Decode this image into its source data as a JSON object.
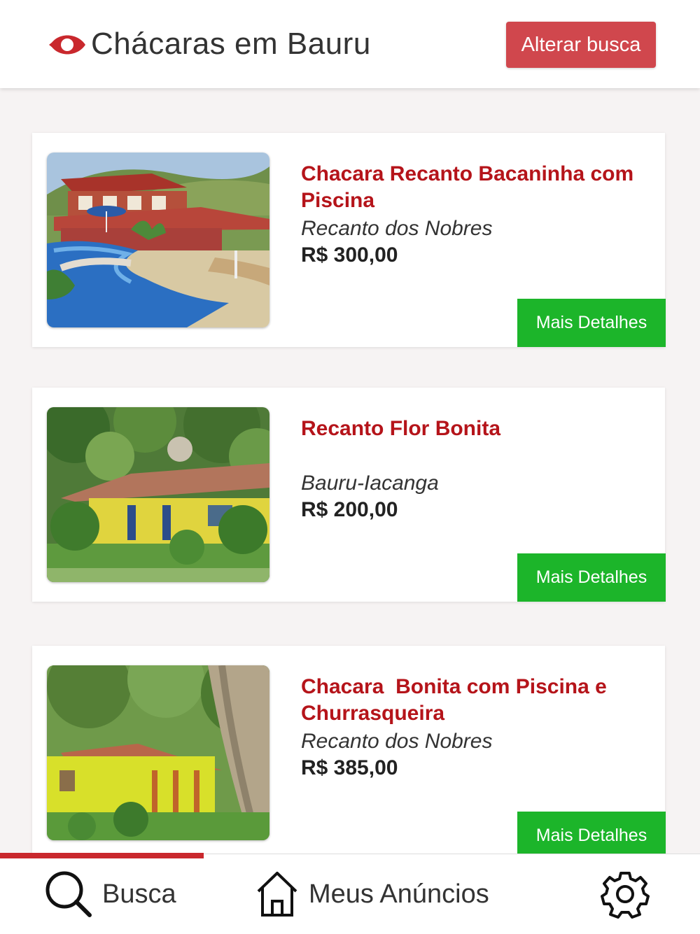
{
  "header": {
    "title": "Chácaras em Bauru",
    "alter_button": "Alterar busca",
    "brand_color": "#c9282d",
    "logo_icon": "eye-pin-logo-icon"
  },
  "listings": [
    {
      "title": "Chacara Recanto Bacaninha com Piscina",
      "location": "Recanto dos Nobres",
      "price": "R$ 300,00",
      "button": "Mais Detalhes",
      "image": "house-with-pool-photo"
    },
    {
      "title": "Recanto Flor Bonita",
      "location": "Bauru-Iacanga",
      "price": "R$ 200,00",
      "button": "Mais Detalhes",
      "image": "yellow-house-with-garden-photo"
    },
    {
      "title": "Chacara  Bonita com Piscina e Churrasqueira",
      "location": "Recanto dos Nobres",
      "price": "R$ 385,00",
      "button": "Mais Detalhes",
      "image": "yellow-house-under-tree-photo"
    }
  ],
  "tabs": [
    {
      "label": "Busca",
      "icon": "search-icon",
      "active": true
    },
    {
      "label": "Meus Anúncios",
      "icon": "home-icon",
      "active": false
    },
    {
      "label": "",
      "icon": "gear-icon",
      "active": false
    }
  ],
  "colors": {
    "title_red": "#b5141a",
    "button_green": "#1cb52a",
    "alter_button_red": "#d0474d"
  }
}
